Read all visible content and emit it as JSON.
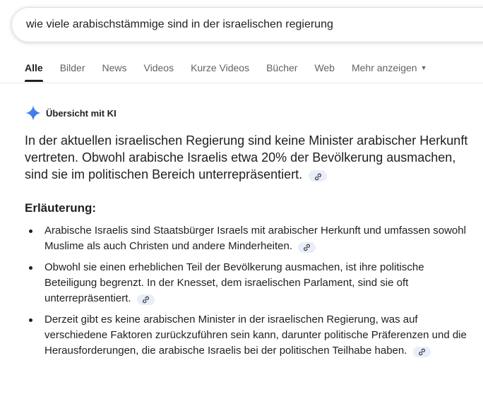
{
  "search": {
    "query": "wie viele arabischstämmige sind in der israelischen regierung"
  },
  "tabs": [
    {
      "label": "Alle",
      "active": true
    },
    {
      "label": "Bilder"
    },
    {
      "label": "News"
    },
    {
      "label": "Videos"
    },
    {
      "label": "Kurze Videos"
    },
    {
      "label": "Bücher"
    },
    {
      "label": "Web"
    },
    {
      "label": "Mehr anzeigen",
      "dropdown": true
    }
  ],
  "ai_overview": {
    "title": "Übersicht mit KI",
    "summary": "In der aktuellen israelischen Regierung sind keine Minister arabischer Herkunft vertreten. Obwohl arabische Israelis etwa 20% der Bevölkerung ausmachen, sind sie im politischen Bereich unterrepräsentiert.",
    "explanation_heading": "Erläuterung:",
    "bullets": [
      "Arabische Israelis sind Staatsbürger Israels mit arabischer Herkunft und umfassen sowohl Muslime als auch Christen und andere Minderheiten.",
      "Obwohl sie einen erheblichen Teil der Bevölkerung ausmachen, ist ihre politische Beteiligung begrenzt. In der Knesset, dem israelischen Parlament, sind sie oft unterrepräsentiert.",
      "Derzeit gibt es keine arabischen Minister in der israelischen Regierung, was auf verschiedene Faktoren zurückzuführen sein kann, darunter politische Präferenzen und die Herausforderungen, die arabische Israelis bei der politischen Teilhabe haben."
    ]
  },
  "icons": {
    "ai": "sparkle-icon",
    "link": "link-icon",
    "dropdown": "caret-down-icon"
  },
  "colors": {
    "accent": "#4285f4",
    "chip_bg": "#e8edf9",
    "text": "#1f1f1f",
    "muted": "#5f6368"
  }
}
